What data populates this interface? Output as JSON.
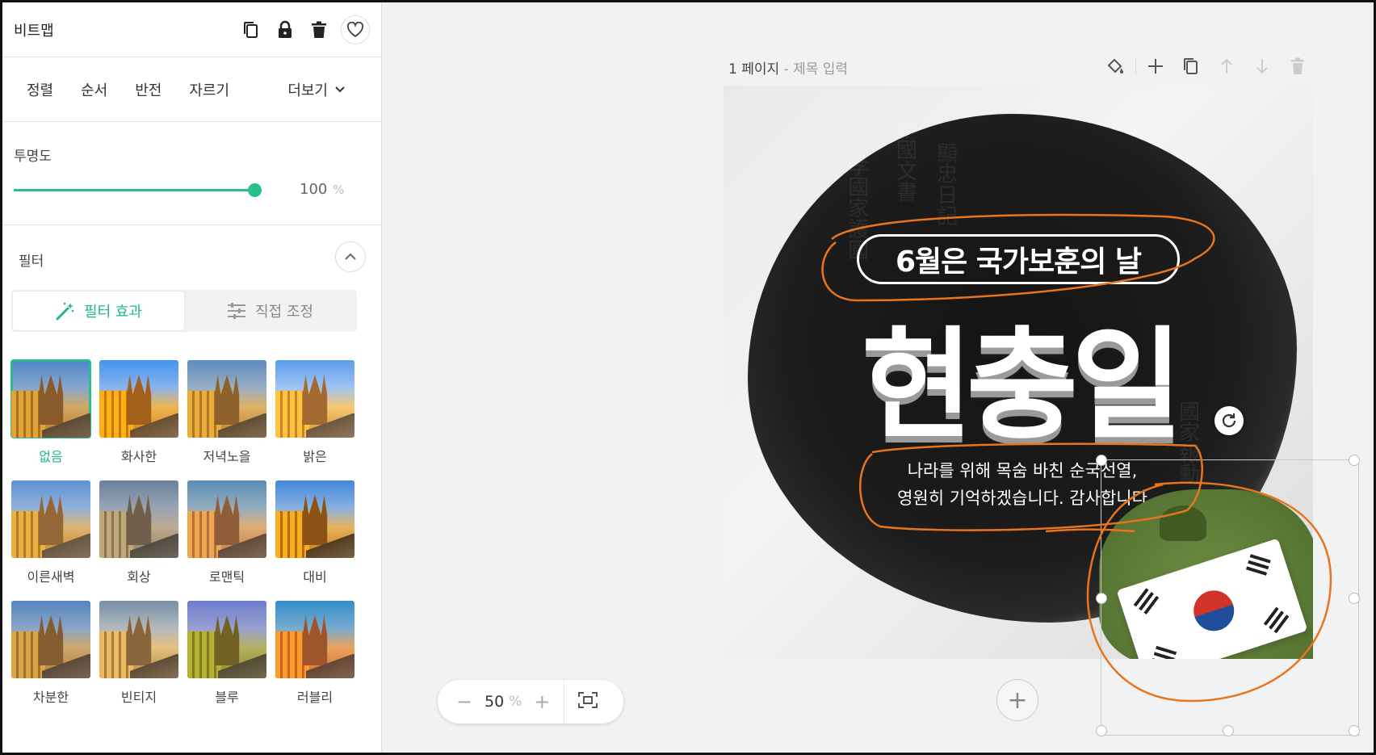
{
  "panel": {
    "title": "비트맵",
    "tabs": [
      "정렬",
      "순서",
      "반전",
      "자르기"
    ],
    "more_label": "더보기",
    "opacity_label": "투명도",
    "opacity_value": "100",
    "opacity_unit": "%",
    "opacity_level": 1.0,
    "filter_label": "필터",
    "filter_tab_effects": "필터 효과",
    "filter_tab_manual": "직접 조정",
    "filters": [
      {
        "label": "없음",
        "selected": true
      },
      {
        "label": "화사한"
      },
      {
        "label": "저녁노을"
      },
      {
        "label": "밝은"
      },
      {
        "label": "이른새벽"
      },
      {
        "label": "회상"
      },
      {
        "label": "로맨틱"
      },
      {
        "label": "대비"
      },
      {
        "label": "차분한"
      },
      {
        "label": "빈티지"
      },
      {
        "label": "블루"
      },
      {
        "label": "러블리"
      }
    ]
  },
  "canvas": {
    "page_number": "1 페이지",
    "page_title_placeholder": "- 제목 입력",
    "pill_text": "6월은 국가보훈의 날",
    "big_title": "현충일",
    "sub_line1": "나라를 위해 목숨 바친 순국선열,",
    "sub_line2": "영원히 기억하겠습니다. 감사합니다"
  },
  "zoom": {
    "value": "50",
    "unit": "%",
    "minus": "−",
    "plus": "+"
  },
  "add_page_symbol": "+",
  "colors": {
    "accent": "#27c08a",
    "annotation": "#e8751e"
  },
  "icons": {
    "copy": "copy-icon",
    "lock": "lock-icon",
    "trash": "trash-icon",
    "heart": "heart-icon",
    "fill": "paint-bucket-icon",
    "up": "arrow-up-icon",
    "down": "arrow-down-icon",
    "fit": "fit-screen-icon",
    "rotate": "rotate-icon"
  }
}
